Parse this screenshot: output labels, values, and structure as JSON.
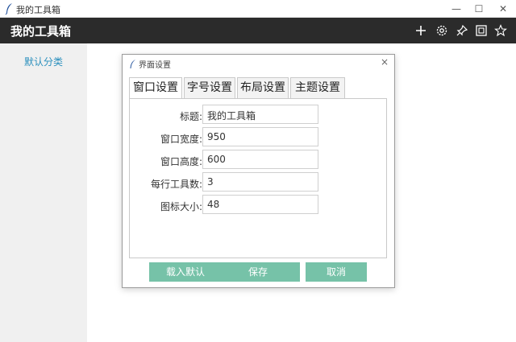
{
  "window": {
    "title": "我的工具箱",
    "controls": {
      "minimize": "—",
      "maximize": "☐",
      "close": "✕"
    }
  },
  "header": {
    "title": "我的工具箱",
    "icons": [
      "add-icon",
      "gear-icon",
      "pin-icon",
      "screen-icon",
      "star-icon"
    ]
  },
  "sidebar": {
    "items": [
      {
        "label": "默认分类"
      }
    ]
  },
  "dialog": {
    "title": "界面设置",
    "close": "×",
    "tabs": [
      "窗口设置",
      "字号设置",
      "布局设置",
      "主题设置"
    ],
    "fields": [
      {
        "label": "标题:",
        "value": "我的工具箱"
      },
      {
        "label": "窗口宽度:",
        "value": "950"
      },
      {
        "label": "窗口高度:",
        "value": "600"
      },
      {
        "label": "每行工具数:",
        "value": "3"
      },
      {
        "label": "图标大小:",
        "value": "48"
      }
    ],
    "buttons": {
      "load_default": "载入默认",
      "save": "保存",
      "cancel": "取消"
    }
  },
  "colors": {
    "header_bg": "#2b2b2b",
    "sidebar_bg": "#f0f0f0",
    "accent_link": "#2a8fbd",
    "button_bg": "#76c2a8"
  }
}
